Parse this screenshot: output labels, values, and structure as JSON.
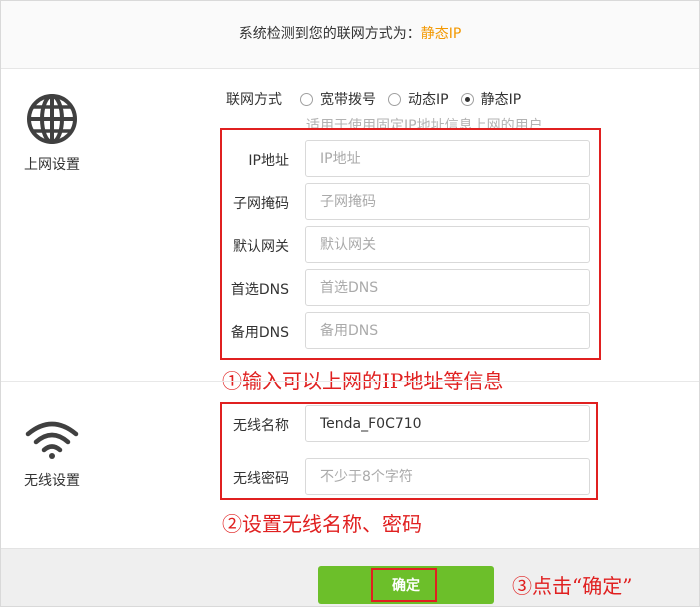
{
  "detect": {
    "prefix": "系统检测到您的联网方式为：",
    "mode": "静态IP"
  },
  "internet": {
    "section_label": "上网设置",
    "icon": "globe-icon",
    "mode_label": "联网方式",
    "modes": [
      {
        "label": "宽带拨号",
        "checked": false
      },
      {
        "label": "动态IP",
        "checked": false
      },
      {
        "label": "静态IP",
        "checked": true
      }
    ],
    "hint": "适用于使用固定IP地址信息上网的用户",
    "fields": [
      {
        "label": "IP地址",
        "value": "",
        "placeholder": "IP地址"
      },
      {
        "label": "子网掩码",
        "value": "",
        "placeholder": "子网掩码"
      },
      {
        "label": "默认网关",
        "value": "",
        "placeholder": "默认网关"
      },
      {
        "label": "首选DNS",
        "value": "",
        "placeholder": "首选DNS"
      },
      {
        "label": "备用DNS",
        "value": "",
        "placeholder": "备用DNS"
      }
    ]
  },
  "wireless": {
    "section_label": "无线设置",
    "icon": "wifi-icon",
    "name_label": "无线名称",
    "name_value": "Tenda_F0C710",
    "password_label": "无线密码",
    "password_placeholder": "不少于8个字符"
  },
  "annotations": {
    "step1": "①输入可以上网的IP地址等信息",
    "step2": "②设置无线名称、密码",
    "step3": "③点击“确定”"
  },
  "footer": {
    "ok_label": "确定"
  },
  "colors": {
    "accent_orange": "#f39800",
    "button_green": "#6cbf2a",
    "annotation_red": "#e02020"
  }
}
